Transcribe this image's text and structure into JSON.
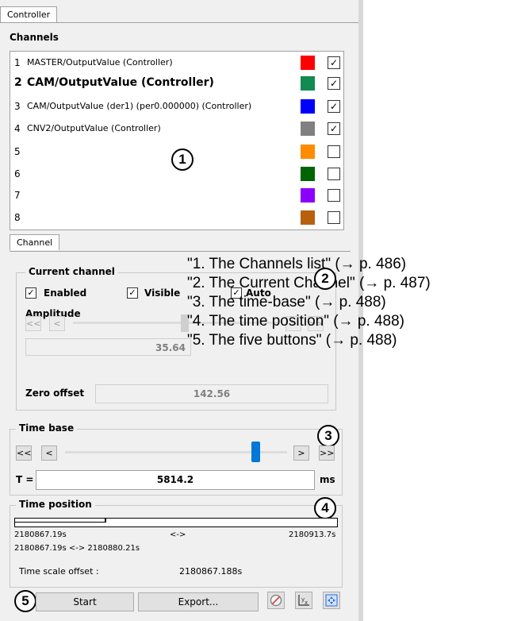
{
  "tabs": {
    "controller": "Controller",
    "channel": "Channel"
  },
  "channels": {
    "header": "Channels",
    "rows": [
      {
        "num": "1",
        "label": "MASTER/OutputValue (Controller)",
        "color": "#ff0000",
        "checked": true
      },
      {
        "num": "2",
        "label": "CAM/OutputValue (Controller)",
        "color": "#128a50",
        "checked": true
      },
      {
        "num": "3",
        "label": "CAM/OutputValue (der1) (per0.000000) (Controller)",
        "color": "#0000ff",
        "checked": true
      },
      {
        "num": "4",
        "label": "CNV2/OutputValue (Controller)",
        "color": "#808080",
        "checked": true
      },
      {
        "num": "5",
        "label": "",
        "color": "#ff8c00",
        "checked": false
      },
      {
        "num": "6",
        "label": "",
        "color": "#006400",
        "checked": false
      },
      {
        "num": "7",
        "label": "",
        "color": "#8b00ff",
        "checked": false
      },
      {
        "num": "8",
        "label": "",
        "color": "#b8600e",
        "checked": false
      }
    ]
  },
  "current_channel": {
    "header": "Current channel",
    "enabled": "Enabled",
    "visible": "Visible",
    "auto": "Auto",
    "amplitude": "Amplitude",
    "btn_first": "<<",
    "btn_prev": "<",
    "btn_next": ">",
    "btn_last": ">>",
    "amplitude_value": "35.64",
    "zero_offset_label": "Zero offset",
    "zero_offset_value": "142.56"
  },
  "time_base": {
    "header": "Time base",
    "btn_first": "<<",
    "btn_prev": "<",
    "btn_next": ">",
    "btn_last": ">>",
    "t_label": "T =",
    "value": "5814.2",
    "unit": "ms"
  },
  "time_position": {
    "header": "Time position",
    "left": "2180867.19s",
    "mid": "<->",
    "right": "2180913.7s",
    "range": "2180867.19s <-> 2180880.21s",
    "offset_label": "Time scale offset :",
    "offset_value": "2180867.188s"
  },
  "buttons": {
    "start": "Start",
    "export": "Export..."
  },
  "callouts": [
    "1",
    "2",
    "3",
    "4",
    "5"
  ],
  "annotations": [
    "\"1. The Channels list\" (→ p. 486)",
    "\"2. The Current Channel\" (→ p. 487)",
    "\"3. The time-base\" (→ p. 488)",
    "\"4. The time position\" (→ p. 488)",
    "\"5. The five buttons\" (→ p. 488)"
  ]
}
